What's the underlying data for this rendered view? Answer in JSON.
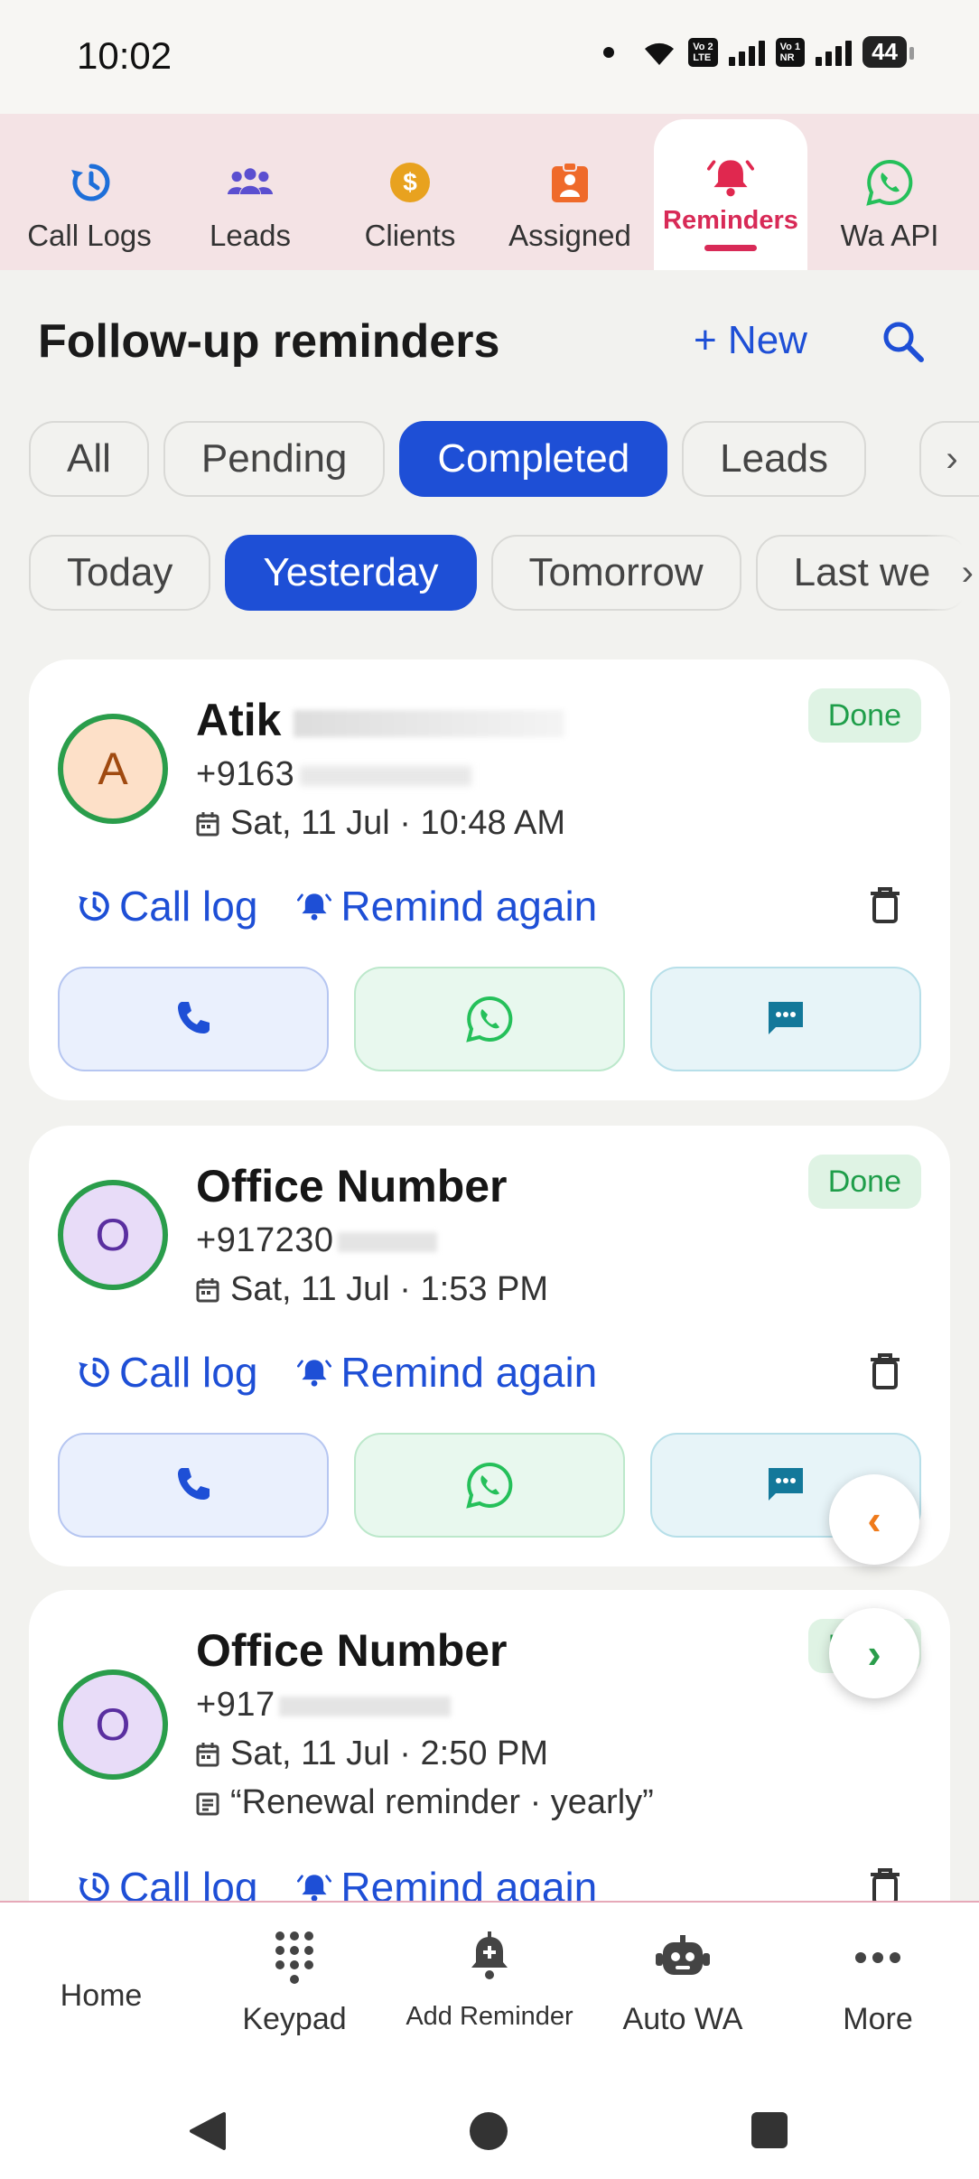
{
  "status_bar": {
    "time": "10:02",
    "battery": "44",
    "sim1": [
      "Vo 2",
      "LTE"
    ],
    "sim2": [
      "Vo 1",
      "NR"
    ]
  },
  "tabs": [
    {
      "label": "Call Logs",
      "icon": "history-icon"
    },
    {
      "label": "Leads",
      "icon": "people-icon"
    },
    {
      "label": "Clients",
      "icon": "dollar-icon"
    },
    {
      "label": "Assigned",
      "icon": "assignment-icon"
    },
    {
      "label": "Reminders",
      "icon": "bell-icon",
      "active": true
    },
    {
      "label": "Wa API",
      "icon": "whatsapp-icon"
    }
  ],
  "header": {
    "title": "Follow-up reminders",
    "new_label": "+ New"
  },
  "filters_type": [
    "All",
    "Pending",
    "Completed",
    "Leads"
  ],
  "filters_type_selected": "Completed",
  "filters_date": [
    "Today",
    "Yesterday",
    "Tomorrow",
    "Last we"
  ],
  "filters_date_selected": "Yesterday",
  "reminders": [
    {
      "initial": "A",
      "name": "Atik",
      "phone": "+9163",
      "datetime": "Sat, 11 Jul · 10:48 AM",
      "status": "Done"
    },
    {
      "initial": "O",
      "name": "Office Number",
      "phone": "+917230",
      "datetime": "Sat, 11 Jul · 1:53 PM",
      "status": "Done"
    },
    {
      "initial": "O",
      "name": "Office Number",
      "phone": "+917",
      "datetime": "Sat, 11 Jul · 2:50 PM",
      "note": "“Renewal reminder · yearly”",
      "status": "Done"
    }
  ],
  "card_actions": {
    "call_log": "Call log",
    "remind_again": "Remind again"
  },
  "bottom_nav": [
    {
      "label": "Home"
    },
    {
      "label": "Keypad",
      "icon": "dialpad-icon"
    },
    {
      "label": "Add Reminder",
      "icon": "bell-plus-icon"
    },
    {
      "label": "Auto WA",
      "icon": "robot-icon"
    },
    {
      "label": "More",
      "icon": "more-icon"
    }
  ],
  "colors": {
    "primary": "#1e4fd6",
    "accent": "#d82a57",
    "done": "#1f9e4a",
    "whatsapp": "#25c05a"
  }
}
